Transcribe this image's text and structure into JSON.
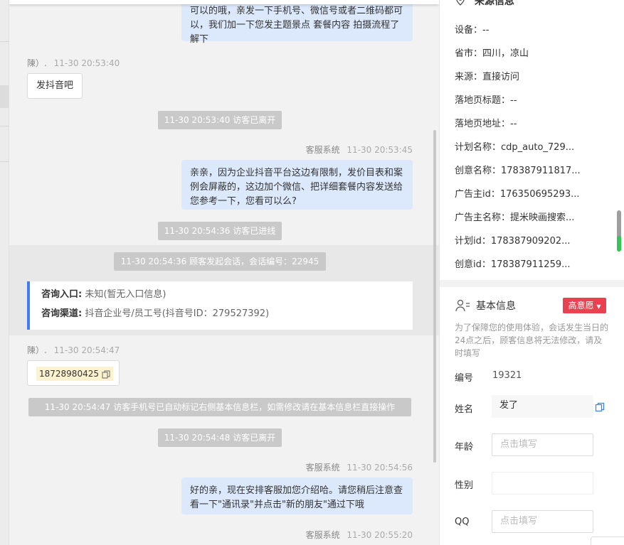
{
  "chat": {
    "msg1_text": "可以的哦，亲发一下手机号、微信号或者二维码都可以，我们加一下您发主题景点 套餐内容 拍摄流程了解下",
    "visitor1": {
      "name": "陳）.",
      "time": "11-30 20:53:40",
      "text": "发抖音吧"
    },
    "sys1": "11-30 20:53:40 访客已离开",
    "agent2": {
      "name": "客服系统",
      "time": "11-30 20:53:45",
      "text": "亲亲，因为企业抖音平台这边有限制，发价目表和案例会屏蔽的，这边加个微信、把详细套餐内容发送给您参考一下，您看可以么?"
    },
    "sys2": "11-30 20:54:36 访客已进线",
    "sys3": "11-30 20:54:36 顾客发起会话，会话编号：22945",
    "consult": {
      "entry_label": "咨询入口:",
      "entry_value": "未知(暂无入口信息)",
      "channel_label": "咨询渠道:",
      "channel_value": "抖音企业号/员工号(抖音号ID：279527392)"
    },
    "visitor2": {
      "name": "陳）.",
      "time": "11-30 20:54:47",
      "phone": "18728980425"
    },
    "sys4": "11-30 20:54:47 访客手机号已自动标记右侧基本信息栏，如需修改请在基本信息栏直接操作",
    "sys5": "11-30 20:54:48 访客已离开",
    "agent3": {
      "name": "客服系统",
      "time": "11-30 20:54:56",
      "text": "好的亲，现在安排客服加您介绍哈。请您稍后注意查看一下\"通讯录\"并点击\"新的朋友\"通过下哦"
    },
    "agent4": {
      "name": "客服系统",
      "time": "11-30 20:55:20"
    }
  },
  "source": {
    "title": "来源信息",
    "rows": [
      "设备：--",
      "省市：四川，凉山",
      "来源：直接访问",
      "落地页标题：--",
      "落地页地址：--",
      "计划名称：cdp_auto_729...",
      "创意名称：178387911817...",
      "广告主id：176350695293...",
      "广告主名称：提米映画搜索...",
      "计划id：178387909202...",
      "创意id：178387911259..."
    ]
  },
  "basic": {
    "title": "基本信息",
    "intent": "高意愿",
    "hint": "为了保障您的使用体验，会话发生当日的24点之后，顾客信息将无法修改，请及时填写",
    "id_label": "编号",
    "id_value": "19321",
    "name_label": "姓名",
    "name_value": "发了",
    "age_label": "年龄",
    "age_placeholder": "点击填写",
    "gender_label": "性别",
    "qq_label": "QQ",
    "qq_placeholder": "点击填写"
  }
}
